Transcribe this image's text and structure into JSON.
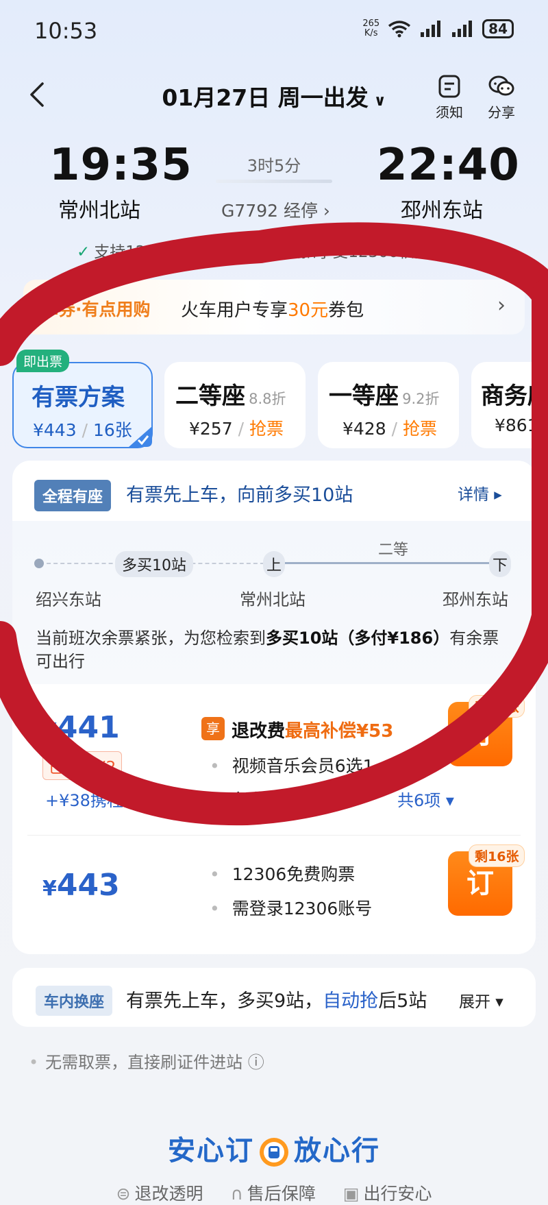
{
  "status": {
    "time": "10:53",
    "netspeed_value": "265",
    "netspeed_unit": "K/s",
    "battery": "84"
  },
  "nav": {
    "title": "01月27日 周一出发",
    "notice_label": "须知",
    "share_label": "分享"
  },
  "journey": {
    "dep_time": "19:35",
    "dep_station": "常州北站",
    "arr_time": "22:40",
    "arr_station": "邳州东站",
    "duration": "3时5分",
    "train_no": "G7792 经停 ›",
    "points_text": "支持12306积分兑换 · 积分抵扣享受12306积分兑换 ›"
  },
  "promo": {
    "tag": "拿券·有点用购",
    "text_prefix": "火车用户专享",
    "text_highlight": "30元",
    "text_suffix": "券包"
  },
  "tabs": [
    {
      "badge": "即出票",
      "name": "有票方案",
      "price": "¥443",
      "extra": "16张"
    },
    {
      "name": "二等座",
      "discount": "8.8折",
      "price": "¥257",
      "extra": "抢票"
    },
    {
      "name": "一等座",
      "discount": "9.2折",
      "price": "¥428",
      "extra": "抢票"
    },
    {
      "name": "商务座",
      "price": "¥861"
    }
  ],
  "fullseat": {
    "tag": "全程有座",
    "text": "有票先上车，向前多买10站",
    "detail": "详情 ▸"
  },
  "route": {
    "start": "绍兴东站",
    "board": "常州北站",
    "end": "邳州东站",
    "extra_pill": "多买10站",
    "up": "上",
    "down": "下",
    "class": "二等"
  },
  "notice": {
    "prefix": "当前班次余票紧张，为您检索到",
    "bold": "多买10站（多付¥186）",
    "suffix": "有余票可出行"
  },
  "option1": {
    "price": "441",
    "already": "已补贴¥2",
    "addon": "+¥38携程全程保障",
    "enjoy_badge": "享",
    "enjoy_title": "退改费",
    "enjoy_highlight": "最高补偿¥53",
    "bullet1": "视频音乐会员6选1",
    "bullet2": "免费改签",
    "more": "共6项 ▾",
    "remain": "剩16张",
    "order": "订"
  },
  "option2": {
    "price": "443",
    "bullet1": "12306免费购票",
    "bullet2": "需登录12306账号",
    "remain": "剩16张",
    "order": "订"
  },
  "change": {
    "tag": "车内换座",
    "prefix": "有票先上车，多买9站，",
    "highlight": "自动抢",
    "suffix": "后5站",
    "expand": "展开 ▾"
  },
  "tip": "无需取票，直接刷证件进站 ⓘ",
  "slogan": {
    "left": "安心订",
    "right": "放心行"
  },
  "footer": [
    "退改透明",
    "售后保障",
    "出行安心"
  ],
  "colors": {
    "accent": "#2a62c9",
    "orange": "#ff7a00",
    "marker": "#c21a2a"
  }
}
